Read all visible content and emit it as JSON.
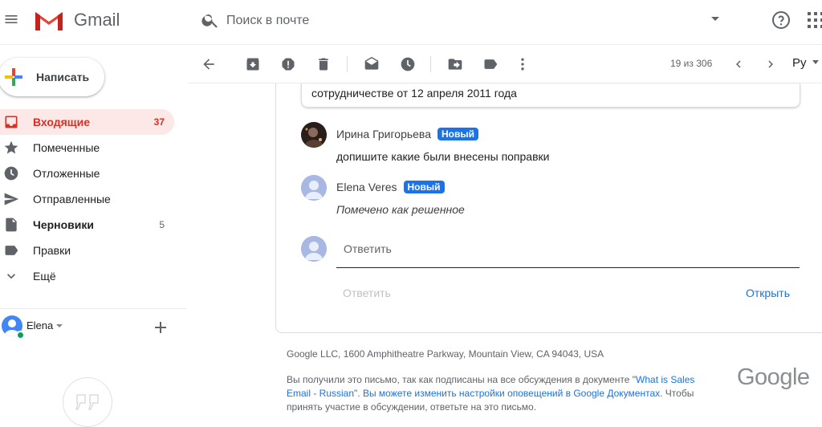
{
  "app": {
    "name": "Gmail"
  },
  "search": {
    "placeholder": "Поиск в почте"
  },
  "sidebar": {
    "compose_label": "Написать",
    "items": [
      {
        "label": "Входящие",
        "count": "37",
        "icon": "inbox-icon"
      },
      {
        "label": "Помеченные",
        "count": "",
        "icon": "star-icon"
      },
      {
        "label": "Отложенные",
        "count": "",
        "icon": "clock-icon"
      },
      {
        "label": "Отправленные",
        "count": "",
        "icon": "send-icon"
      },
      {
        "label": "Черновики",
        "count": "5",
        "icon": "draft-icon"
      },
      {
        "label": "Правки",
        "count": "",
        "icon": "label-icon"
      },
      {
        "label": "Ещё",
        "count": "",
        "icon": "chevron-down-icon"
      }
    ],
    "hangouts_user": "Elena"
  },
  "toolbar": {
    "pager": "19 из 306",
    "lang": "Ру"
  },
  "thread": {
    "quoted_text": "сотрудничестве от 12 апреля 2011 года",
    "comments": [
      {
        "author": "Ирина Григорьева",
        "badge": "Новый",
        "body": "допишите какие были внесены поправки"
      },
      {
        "author": "Elena Veres",
        "badge": "Новый",
        "body": "Помечено как решенное"
      }
    ],
    "reply_placeholder": "Ответить",
    "reply_button": "Ответить",
    "open_button": "Открыть"
  },
  "footer": {
    "address": "Google LLC, 1600 Amphitheatre Parkway, Mountain View, CA 94043, USA",
    "notice_1": "Вы получили это письмо, так как подписаны на все обсуждения в документе \"",
    "doc_link": "What is Sales Email - Russian",
    "notice_2": "\". ",
    "settings_link": "Вы можете изменить настройки оповещений в Google Документах",
    "notice_3": ". Чтобы принять участие в обсуждении, ответьте на это письмо.",
    "logo_text": "Google"
  },
  "colors": {
    "accent": "#1a73e8",
    "inbox_active": "#d93025",
    "inbox_bg": "#fce8e6"
  }
}
